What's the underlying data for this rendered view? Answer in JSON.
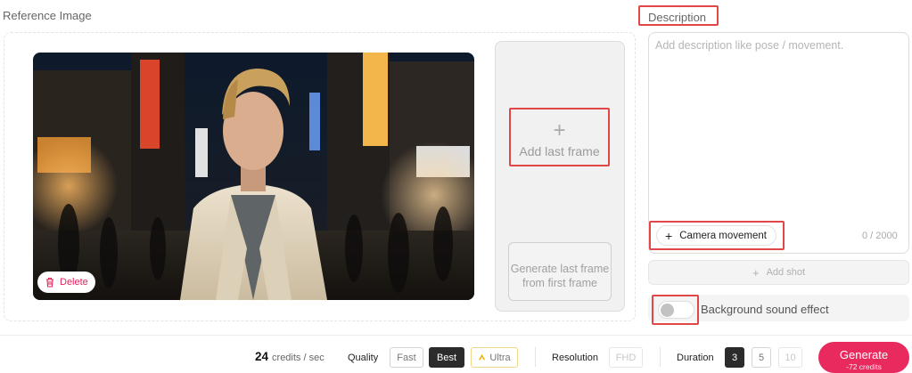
{
  "reference": {
    "title": "Reference Image",
    "image_alt": "Young man with blond hair in a beige blazer on a neon-lit night city street",
    "delete_label": "Delete",
    "last_frame": {
      "add_label": "Add last frame",
      "generate_label": "Generate last frame from first frame"
    }
  },
  "description": {
    "title": "Description",
    "placeholder": "Add description like pose / movement.",
    "value": "",
    "camera_movement_label": "Camera movement",
    "counter": "0 / 2000",
    "add_shot_label": "Add shot",
    "sound_effect_label": "Background sound effect",
    "sound_effect_enabled": false
  },
  "footer": {
    "credits_value": "24",
    "credits_unit": "credits / sec",
    "quality_label": "Quality",
    "quality_options": [
      "Fast",
      "Best",
      "Ultra"
    ],
    "quality_selected": "Best",
    "resolution_label": "Resolution",
    "resolution_options": [
      "FHD"
    ],
    "duration_label": "Duration",
    "duration_options": [
      "3",
      "5",
      "10"
    ],
    "duration_selected": "3",
    "generate_label": "Generate",
    "generate_cost": "-72 credits"
  },
  "colors": {
    "accent": "#e92a5f",
    "highlight_box": "#e04848",
    "ultra_icon": "#f0b400"
  },
  "icons": {
    "delete": "trash-icon",
    "add": "plus-icon",
    "ultra": "crown-icon"
  }
}
